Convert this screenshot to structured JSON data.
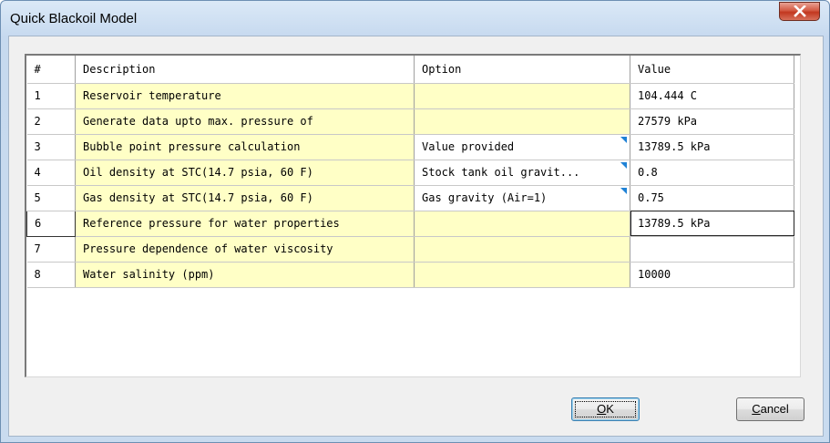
{
  "window": {
    "title": "Quick Blackoil Model",
    "close_icon": "close-icon"
  },
  "grid": {
    "columns": [
      "#",
      "Description",
      "Option",
      "Value"
    ],
    "rows": [
      {
        "num": "1",
        "description": "Reservoir temperature",
        "option": "",
        "value": "104.444 C",
        "has_dropdown": false
      },
      {
        "num": "2",
        "description": "Generate data upto max. pressure of",
        "option": "",
        "value": "27579 kPa",
        "has_dropdown": false
      },
      {
        "num": "3",
        "description": "Bubble point pressure calculation",
        "option": "Value provided",
        "value": "13789.5 kPa",
        "has_dropdown": true
      },
      {
        "num": "4",
        "description": "Oil density at STC(14.7 psia, 60 F)",
        "option": "Stock tank oil gravit...",
        "value": "0.8",
        "has_dropdown": true
      },
      {
        "num": "5",
        "description": "Gas density at STC(14.7 psia, 60 F)",
        "option": "Gas gravity (Air=1)",
        "value": "0.75",
        "has_dropdown": true
      },
      {
        "num": "6",
        "description": "Reference pressure for water properties",
        "option": "",
        "value": "13789.5 kPa",
        "has_dropdown": false,
        "current": true
      },
      {
        "num": "7",
        "description": "Pressure dependence of water viscosity",
        "option": "",
        "value": "",
        "has_dropdown": false
      },
      {
        "num": "8",
        "description": "Water salinity (ppm)",
        "option": "",
        "value": "10000",
        "has_dropdown": false
      }
    ]
  },
  "buttons": {
    "ok": {
      "mnemonic": "O",
      "rest": "K"
    },
    "cancel": {
      "mnemonic": "C",
      "rest": "ancel"
    }
  },
  "colors": {
    "editable_cell": "#ffffc6",
    "dropdown_marker": "#1f82d6"
  }
}
